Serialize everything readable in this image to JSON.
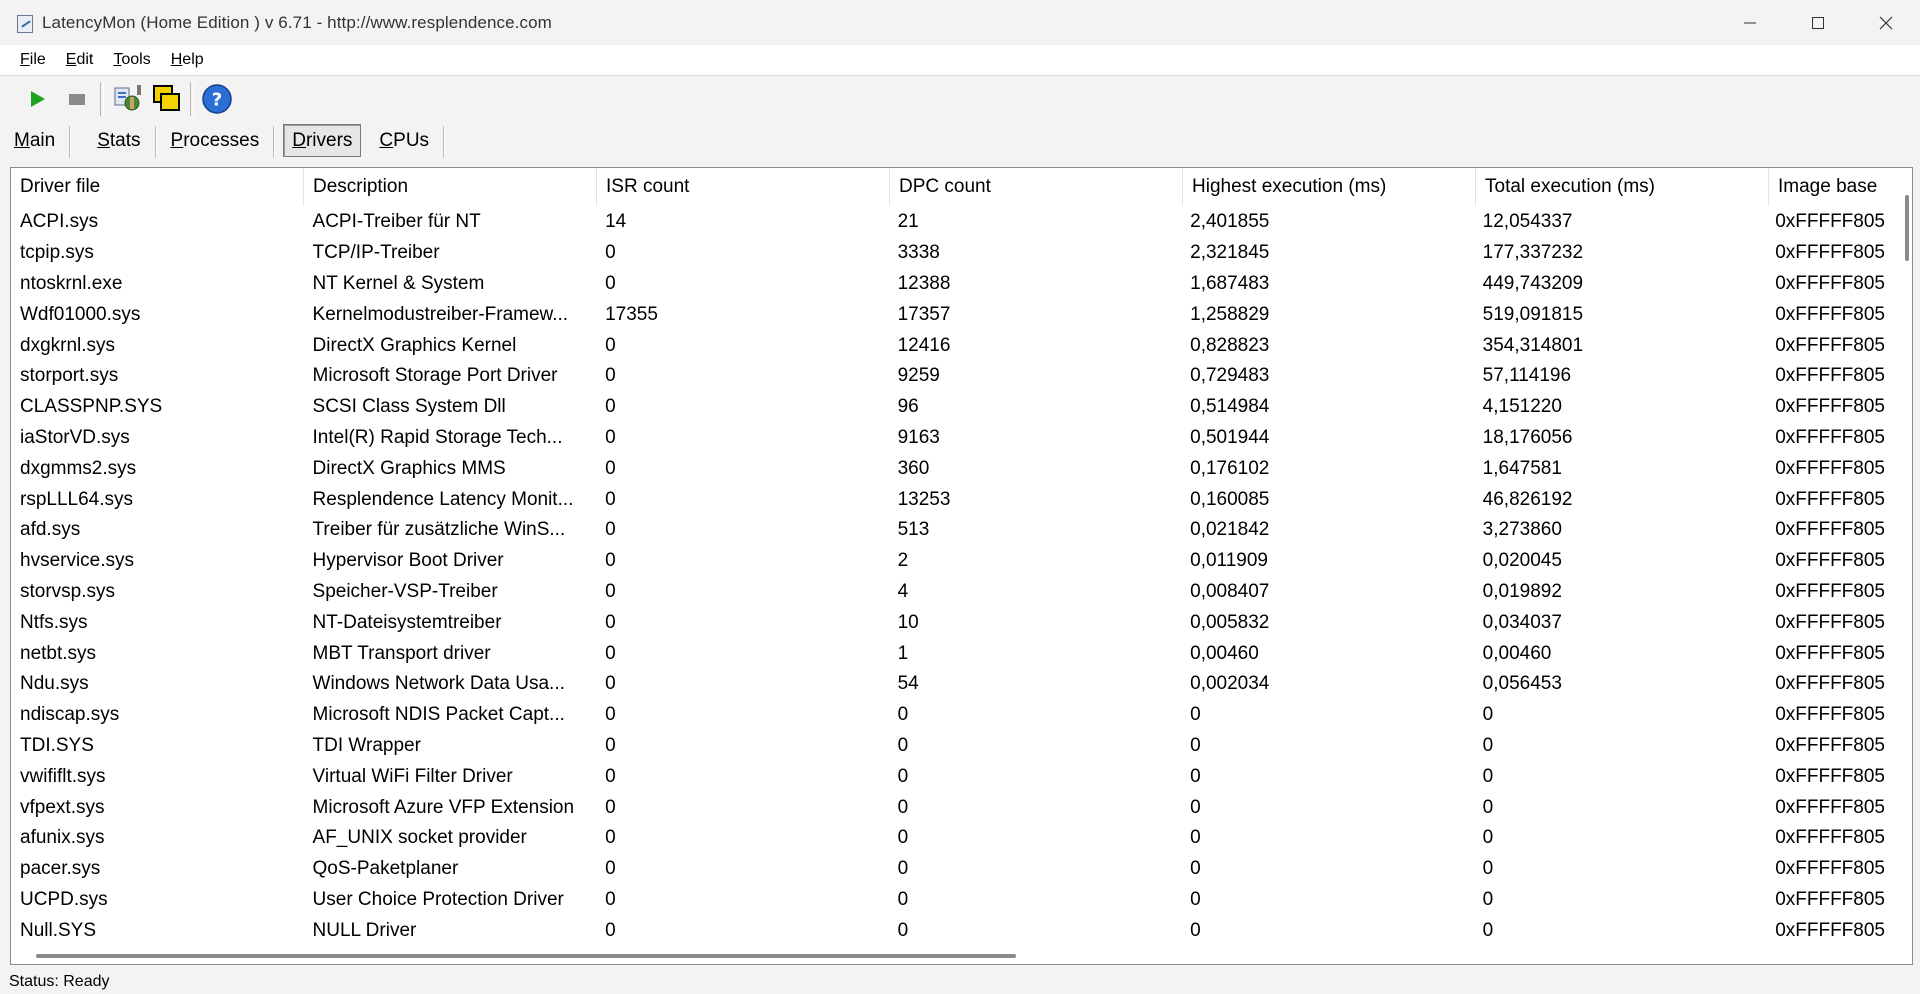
{
  "window": {
    "title": "LatencyMon  (Home Edition )  v 6.71 - http://www.resplendence.com",
    "controls": [
      "minimize-icon",
      "maximize-icon",
      "close-icon"
    ]
  },
  "menu": [
    {
      "underline": "F",
      "rest": "ile"
    },
    {
      "underline": "E",
      "rest": "dit"
    },
    {
      "underline": "T",
      "rest": "ools"
    },
    {
      "underline": "H",
      "rest": "elp"
    }
  ],
  "toolbar": {
    "icons": [
      "play-icon",
      "stop-icon",
      "driver-settings-icon",
      "windows-icon",
      "help-icon"
    ],
    "colors": {
      "play": "#1fa31f",
      "stop": "#8a8a8a",
      "help": "#2a6fd6"
    }
  },
  "tabs": [
    {
      "underline": "M",
      "rest": "ain",
      "active": false
    },
    {
      "underline": "S",
      "rest": "tats",
      "active": false
    },
    {
      "underline": "P",
      "rest": "rocesses",
      "active": false
    },
    {
      "underline": "D",
      "rest": "rivers",
      "active": true
    },
    {
      "underline": "C",
      "rest": "PUs",
      "active": false
    }
  ],
  "table": {
    "columns": [
      "Driver file",
      "Description",
      "ISR count",
      "DPC count",
      "Highest execution (ms)",
      "Total execution (ms)",
      "Image base"
    ],
    "rows": [
      [
        "ACPI.sys",
        "ACPI-Treiber für NT",
        "14",
        "21",
        "2,401855",
        "12,054337",
        "0xFFFFF805"
      ],
      [
        "tcpip.sys",
        "TCP/IP-Treiber",
        "0",
        "3338",
        "2,321845",
        "177,337232",
        "0xFFFFF805"
      ],
      [
        "ntoskrnl.exe",
        "NT Kernel & System",
        "0",
        "12388",
        "1,687483",
        "449,743209",
        "0xFFFFF805"
      ],
      [
        "Wdf01000.sys",
        "Kernelmodustreiber-Framew...",
        "17355",
        "17357",
        "1,258829",
        "519,091815",
        "0xFFFFF805"
      ],
      [
        "dxgkrnl.sys",
        "DirectX Graphics Kernel",
        "0",
        "12416",
        "0,828823",
        "354,314801",
        "0xFFFFF805"
      ],
      [
        "storport.sys",
        "Microsoft Storage Port Driver",
        "0",
        "9259",
        "0,729483",
        "57,114196",
        "0xFFFFF805"
      ],
      [
        "CLASSPNP.SYS",
        "SCSI Class System Dll",
        "0",
        "96",
        "0,514984",
        "4,151220",
        "0xFFFFF805"
      ],
      [
        "iaStorVD.sys",
        "Intel(R) Rapid Storage Tech...",
        "0",
        "9163",
        "0,501944",
        "18,176056",
        "0xFFFFF805"
      ],
      [
        "dxgmms2.sys",
        "DirectX Graphics MMS",
        "0",
        "360",
        "0,176102",
        "1,647581",
        "0xFFFFF805"
      ],
      [
        "rspLLL64.sys",
        "Resplendence Latency Monit...",
        "0",
        "13253",
        "0,160085",
        "46,826192",
        "0xFFFFF805"
      ],
      [
        "afd.sys",
        "Treiber für zusätzliche WinS...",
        "0",
        "513",
        "0,021842",
        "3,273860",
        "0xFFFFF805"
      ],
      [
        "hvservice.sys",
        "Hypervisor Boot Driver",
        "0",
        "2",
        "0,011909",
        "0,020045",
        "0xFFFFF805"
      ],
      [
        "storvsp.sys",
        "Speicher-VSP-Treiber",
        "0",
        "4",
        "0,008407",
        "0,019892",
        "0xFFFFF805"
      ],
      [
        "Ntfs.sys",
        "NT-Dateisystemtreiber",
        "0",
        "10",
        "0,005832",
        "0,034037",
        "0xFFFFF805"
      ],
      [
        "netbt.sys",
        "MBT Transport driver",
        "0",
        "1",
        "0,00460",
        "0,00460",
        "0xFFFFF805"
      ],
      [
        "Ndu.sys",
        "Windows Network Data Usa...",
        "0",
        "54",
        "0,002034",
        "0,056453",
        "0xFFFFF805"
      ],
      [
        "ndiscap.sys",
        "Microsoft NDIS Packet Capt...",
        "0",
        "0",
        "0",
        "0",
        "0xFFFFF805"
      ],
      [
        "TDI.SYS",
        "TDI Wrapper",
        "0",
        "0",
        "0",
        "0",
        "0xFFFFF805"
      ],
      [
        "vwififlt.sys",
        "Virtual WiFi Filter Driver",
        "0",
        "0",
        "0",
        "0",
        "0xFFFFF805"
      ],
      [
        "vfpext.sys",
        "Microsoft Azure VFP Extension",
        "0",
        "0",
        "0",
        "0",
        "0xFFFFF805"
      ],
      [
        "afunix.sys",
        "AF_UNIX socket provider",
        "0",
        "0",
        "0",
        "0",
        "0xFFFFF805"
      ],
      [
        "pacer.sys",
        "QoS-Paketplaner",
        "0",
        "0",
        "0",
        "0",
        "0xFFFFF805"
      ],
      [
        "UCPD.sys",
        "User Choice Protection Driver",
        "0",
        "0",
        "0",
        "0",
        "0xFFFFF805"
      ],
      [
        "Null.SYS",
        "NULL Driver",
        "0",
        "0",
        "0",
        "0",
        "0xFFFFF805"
      ]
    ]
  },
  "status": {
    "text": "Status: Ready"
  }
}
